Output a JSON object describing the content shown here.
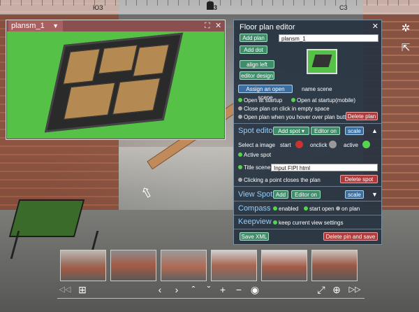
{
  "compass": {
    "labels": [
      "ЮЗ",
      "3",
      "С3"
    ]
  },
  "plan_window": {
    "tab_label": "plansm_1",
    "dropdown_glyph": "▼",
    "fullscreen_glyph": "⛶",
    "close_glyph": "✕"
  },
  "editor": {
    "title": "Floor plan editor",
    "close_glyph": "✕",
    "add_plan": "Add plan",
    "plan_name_value": "plansm_1",
    "add_dot": "Add dot",
    "align_left": "align left",
    "editor_design": "editor design",
    "assign_open_scene": "Assign an open scene",
    "name_scene": "name scene",
    "open_at_startup": "Open at startup",
    "open_at_startup_mobile": "Open at startup(mobile)",
    "close_plan_on_click": "Close plan on click in empty space",
    "open_plan_on_hover": "Open plan when you hover over plan button",
    "delete_plan": "Delete plan",
    "spot_editor": {
      "title": "Spot editor",
      "add_spot": "Add spot",
      "add_spot_arrow": "▾",
      "editor_on": "Editor on",
      "scale": "scale",
      "collapse": "▲",
      "select_image": "Select a image",
      "start": "start",
      "onclick": "onclick",
      "active": "active",
      "active_spot": "Active spot",
      "title_scene": "Title scene",
      "title_scene_value": "Input FIPI html",
      "clicking_closes": "Clicking a point closes the plan",
      "delete_spot": "Delete spot"
    },
    "view_spot": {
      "title": "View Spot",
      "add": "Add",
      "editor_on": "Editor on",
      "scale": "scale",
      "expand": "▼"
    },
    "compass_section": {
      "title": "Compass",
      "enabled": "enabled",
      "start_open": "start open",
      "on_plan": "on plan"
    },
    "keepview": {
      "title": "Keepview",
      "keep_current": "keep current view settings"
    },
    "save_xml": "Save XML",
    "delete_pin_save": "Delete pin and save"
  },
  "side_icons": {
    "compass_rose": "✲",
    "external": "⇱"
  },
  "thumbnails": [
    "thumb-1",
    "thumb-2",
    "thumb-3",
    "thumb-4",
    "thumb-5",
    "thumb-6"
  ],
  "controls": {
    "rewind": "◁◁",
    "grid": "⊞",
    "left": "‹",
    "right": "›",
    "up": "ˆ",
    "down": "ˇ",
    "zoom_in": "+",
    "zoom_out": "−",
    "eye": "◉",
    "fullscreen": "⤢",
    "down_circle": "⊕",
    "forward": "▷▷"
  },
  "colors": {
    "panel_bg": "#283442",
    "button_green": "#3f8c6b",
    "button_red": "#b23a3a",
    "plan_title_bar": "#8a5050",
    "plan_bg": "#55c247",
    "section_title": "#8fd0ff"
  }
}
